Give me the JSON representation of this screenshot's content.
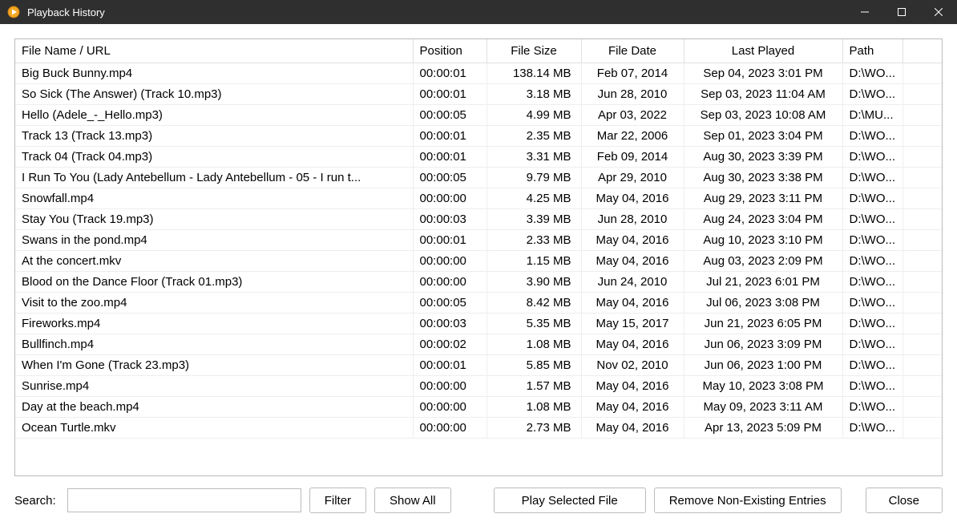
{
  "window": {
    "title": "Playback History"
  },
  "table": {
    "headers": {
      "filename": "File Name / URL",
      "position": "Position",
      "filesize": "File Size",
      "filedate": "File Date",
      "lastplayed": "Last Played",
      "path": "Path"
    },
    "rows": [
      {
        "filename": "Big Buck Bunny.mp4",
        "position": "00:00:01",
        "filesize": "138.14 MB",
        "filedate": "Feb 07, 2014",
        "lastplayed": "Sep 04, 2023 3:01 PM",
        "path": "D:\\WO..."
      },
      {
        "filename": "So Sick (The Answer) (Track 10.mp3)",
        "position": "00:00:01",
        "filesize": "3.18 MB",
        "filedate": "Jun 28, 2010",
        "lastplayed": "Sep 03, 2023 11:04 AM",
        "path": "D:\\WO..."
      },
      {
        "filename": "Hello (Adele_-_Hello.mp3)",
        "position": "00:00:05",
        "filesize": "4.99 MB",
        "filedate": "Apr 03, 2022",
        "lastplayed": "Sep 03, 2023 10:08 AM",
        "path": "D:\\MU..."
      },
      {
        "filename": "Track 13 (Track 13.mp3)",
        "position": "00:00:01",
        "filesize": "2.35 MB",
        "filedate": "Mar 22, 2006",
        "lastplayed": "Sep 01, 2023 3:04 PM",
        "path": "D:\\WO..."
      },
      {
        "filename": "Track 04 (Track 04.mp3)",
        "position": "00:00:01",
        "filesize": "3.31 MB",
        "filedate": "Feb 09, 2014",
        "lastplayed": "Aug 30, 2023 3:39 PM",
        "path": "D:\\WO..."
      },
      {
        "filename": "I Run To You (Lady Antebellum - Lady Antebellum - 05 - I run t...",
        "position": "00:00:05",
        "filesize": "9.79 MB",
        "filedate": "Apr 29, 2010",
        "lastplayed": "Aug 30, 2023 3:38 PM",
        "path": "D:\\WO..."
      },
      {
        "filename": "Snowfall.mp4",
        "position": "00:00:00",
        "filesize": "4.25 MB",
        "filedate": "May 04, 2016",
        "lastplayed": "Aug 29, 2023 3:11 PM",
        "path": "D:\\WO..."
      },
      {
        "filename": "Stay You (Track 19.mp3)",
        "position": "00:00:03",
        "filesize": "3.39 MB",
        "filedate": "Jun 28, 2010",
        "lastplayed": "Aug 24, 2023 3:04 PM",
        "path": "D:\\WO..."
      },
      {
        "filename": "Swans in the pond.mp4",
        "position": "00:00:01",
        "filesize": "2.33 MB",
        "filedate": "May 04, 2016",
        "lastplayed": "Aug 10, 2023 3:10 PM",
        "path": "D:\\WO..."
      },
      {
        "filename": "At the concert.mkv",
        "position": "00:00:00",
        "filesize": "1.15 MB",
        "filedate": "May 04, 2016",
        "lastplayed": "Aug 03, 2023 2:09 PM",
        "path": "D:\\WO..."
      },
      {
        "filename": "Blood on the Dance Floor (Track 01.mp3)",
        "position": "00:00:00",
        "filesize": "3.90 MB",
        "filedate": "Jun 24, 2010",
        "lastplayed": "Jul 21, 2023 6:01 PM",
        "path": "D:\\WO..."
      },
      {
        "filename": "Visit to the zoo.mp4",
        "position": "00:00:05",
        "filesize": "8.42 MB",
        "filedate": "May 04, 2016",
        "lastplayed": "Jul 06, 2023 3:08 PM",
        "path": "D:\\WO..."
      },
      {
        "filename": "Fireworks.mp4",
        "position": "00:00:03",
        "filesize": "5.35 MB",
        "filedate": "May 15, 2017",
        "lastplayed": "Jun 21, 2023 6:05 PM",
        "path": "D:\\WO..."
      },
      {
        "filename": "Bullfinch.mp4",
        "position": "00:00:02",
        "filesize": "1.08 MB",
        "filedate": "May 04, 2016",
        "lastplayed": "Jun 06, 2023 3:09 PM",
        "path": "D:\\WO..."
      },
      {
        "filename": "When I'm Gone (Track 23.mp3)",
        "position": "00:00:01",
        "filesize": "5.85 MB",
        "filedate": "Nov 02, 2010",
        "lastplayed": "Jun 06, 2023 1:00 PM",
        "path": "D:\\WO..."
      },
      {
        "filename": "Sunrise.mp4",
        "position": "00:00:00",
        "filesize": "1.57 MB",
        "filedate": "May 04, 2016",
        "lastplayed": "May 10, 2023 3:08 PM",
        "path": "D:\\WO..."
      },
      {
        "filename": "Day at the beach.mp4",
        "position": "00:00:00",
        "filesize": "1.08 MB",
        "filedate": "May 04, 2016",
        "lastplayed": "May 09, 2023 3:11 AM",
        "path": "D:\\WO..."
      },
      {
        "filename": "Ocean Turtle.mkv",
        "position": "00:00:00",
        "filesize": "2.73 MB",
        "filedate": "May 04, 2016",
        "lastplayed": "Apr 13, 2023 5:09 PM",
        "path": "D:\\WO..."
      }
    ]
  },
  "bottom": {
    "search_label": "Search:",
    "filter": "Filter",
    "show_all": "Show All",
    "play_selected": "Play Selected File",
    "remove_nonexisting": "Remove Non-Existing Entries",
    "close": "Close"
  }
}
